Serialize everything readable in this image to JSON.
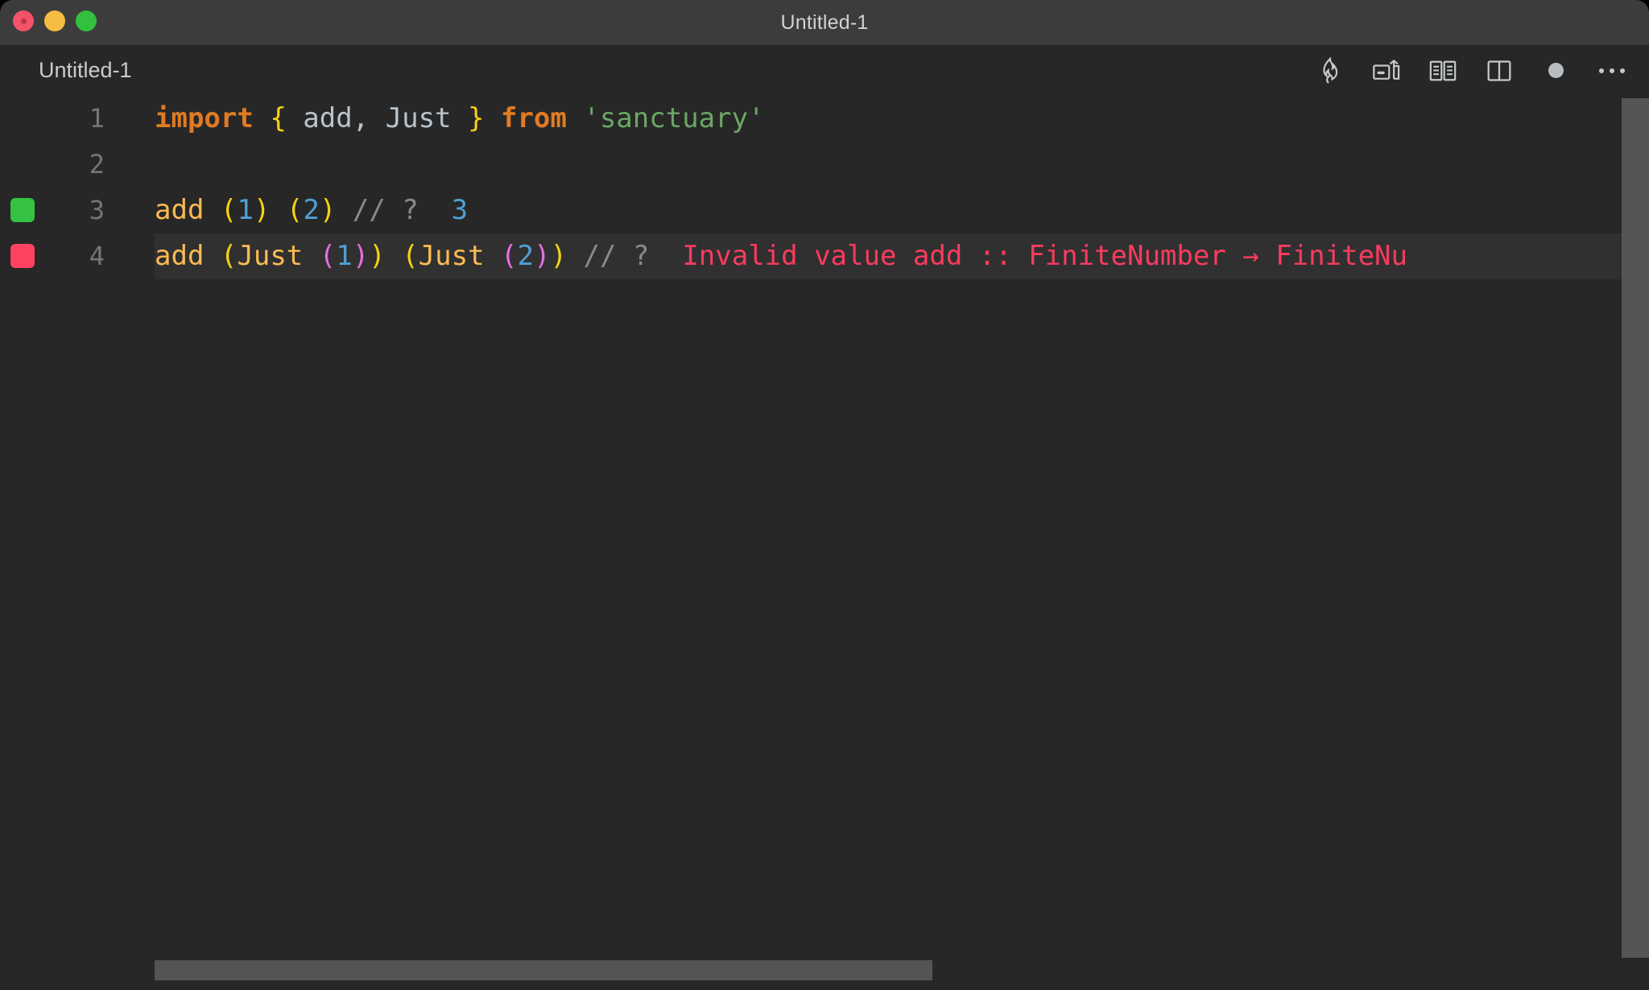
{
  "window": {
    "title": "Untitled-1",
    "traffic_lights": [
      {
        "name": "close",
        "color": "#f4516a"
      },
      {
        "name": "minimize",
        "color": "#f5bd41"
      },
      {
        "name": "zoom",
        "color": "#33c03f"
      }
    ]
  },
  "tab": {
    "label": "Untitled-1"
  },
  "toolbar": {
    "icons": [
      {
        "name": "flame-icon",
        "label": "Run / Quokka"
      },
      {
        "name": "split-terminal-icon",
        "label": "Split Terminal"
      },
      {
        "name": "open-preview-icon",
        "label": "Open Preview"
      },
      {
        "name": "split-editor-icon",
        "label": "Split Editor Right"
      },
      {
        "name": "unsaved-dot-icon",
        "label": "Unsaved changes"
      },
      {
        "name": "more-actions-icon",
        "label": "More Actions..."
      }
    ]
  },
  "editor": {
    "lines": [
      {
        "number": "1",
        "marker": "none",
        "highlight": false,
        "tokens": [
          {
            "cls": "t-keyword",
            "text": "import"
          },
          {
            "cls": "t-punct",
            "text": " "
          },
          {
            "cls": "t-brace",
            "text": "{"
          },
          {
            "cls": "t-ident",
            "text": " add"
          },
          {
            "cls": "t-punct",
            "text": ","
          },
          {
            "cls": "t-ident",
            "text": " Just "
          },
          {
            "cls": "t-brace",
            "text": "}"
          },
          {
            "cls": "t-punct",
            "text": " "
          },
          {
            "cls": "t-keyword",
            "text": "from"
          },
          {
            "cls": "t-punct",
            "text": " "
          },
          {
            "cls": "t-string",
            "text": "'sanctuary'"
          }
        ],
        "plain": "import { add, Just } from 'sanctuary'"
      },
      {
        "number": "2",
        "marker": "none",
        "highlight": false,
        "tokens": [],
        "plain": ""
      },
      {
        "number": "3",
        "marker": "ok",
        "highlight": false,
        "tokens": [
          {
            "cls": "t-fn",
            "text": "add"
          },
          {
            "cls": "t-punct",
            "text": " "
          },
          {
            "cls": "t-paren-y",
            "text": "("
          },
          {
            "cls": "t-num",
            "text": "1"
          },
          {
            "cls": "t-paren-y",
            "text": ")"
          },
          {
            "cls": "t-punct",
            "text": " "
          },
          {
            "cls": "t-paren-y",
            "text": "("
          },
          {
            "cls": "t-num",
            "text": "2"
          },
          {
            "cls": "t-paren-y",
            "text": ")"
          },
          {
            "cls": "t-punct",
            "text": " "
          },
          {
            "cls": "t-comment",
            "text": "// ?"
          },
          {
            "cls": "t-punct",
            "text": "  "
          },
          {
            "cls": "t-num",
            "text": "3"
          }
        ],
        "plain": "add (1) (2) // ?  3"
      },
      {
        "number": "4",
        "marker": "error",
        "highlight": true,
        "tokens": [
          {
            "cls": "t-fn",
            "text": "add"
          },
          {
            "cls": "t-punct",
            "text": " "
          },
          {
            "cls": "t-paren-y",
            "text": "("
          },
          {
            "cls": "t-ctor",
            "text": "Just"
          },
          {
            "cls": "t-punct",
            "text": " "
          },
          {
            "cls": "t-paren-m",
            "text": "("
          },
          {
            "cls": "t-num",
            "text": "1"
          },
          {
            "cls": "t-paren-m",
            "text": ")"
          },
          {
            "cls": "t-paren-y",
            "text": ")"
          },
          {
            "cls": "t-punct",
            "text": " "
          },
          {
            "cls": "t-paren-y",
            "text": "("
          },
          {
            "cls": "t-ctor",
            "text": "Just"
          },
          {
            "cls": "t-punct",
            "text": " "
          },
          {
            "cls": "t-paren-m",
            "text": "("
          },
          {
            "cls": "t-num",
            "text": "2"
          },
          {
            "cls": "t-paren-m",
            "text": ")"
          },
          {
            "cls": "t-paren-y",
            "text": ")"
          },
          {
            "cls": "t-punct",
            "text": " "
          },
          {
            "cls": "t-comment",
            "text": "// ?"
          },
          {
            "cls": "t-punct",
            "text": "  "
          },
          {
            "cls": "t-error",
            "text": "Invalid value add :: FiniteNumber → FiniteNu"
          }
        ],
        "plain": "add (Just (1)) (Just (2)) // ?  Invalid value add :: FiniteNumber → FiniteNu"
      }
    ]
  },
  "scrollbars": {
    "vertical": {
      "name": "vertical-scrollbar"
    },
    "horizontal": {
      "name": "horizontal-scrollbar"
    }
  },
  "colors": {
    "window_chrome": "#3c3c3c",
    "editor_bg": "#272727",
    "line_highlight": "#303030",
    "gutter_ok": "#35c242",
    "gutter_error": "#ff4261",
    "error_text": "#fb3b5e",
    "keyword": "#e07b23",
    "string": "#6aa764",
    "number": "#4f9fd4",
    "function": "#fcbb53",
    "paren_yellow": "#f8d210",
    "paren_magenta": "#e66ee6",
    "comment": "#8a8a8a",
    "scrollbar": "#555555"
  }
}
